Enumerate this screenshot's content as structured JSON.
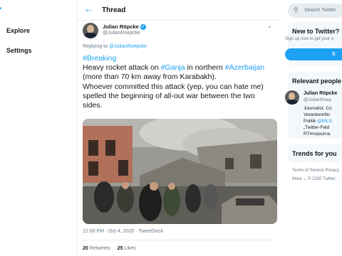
{
  "sidebar": {
    "items": [
      {
        "label": "Explore"
      },
      {
        "label": "Settings"
      }
    ]
  },
  "header": {
    "back_icon": "arrow-left-icon",
    "title": "Thread"
  },
  "tweet": {
    "author_name": "Julian Röpcke",
    "author_handle": "@JulianRoepcke",
    "replying_prefix": "Replying to",
    "replying_handle": "@JulianRoepcke",
    "line1": "#Breaking",
    "line2_pre": "Heavy rocket attack on ",
    "line2_tag1": "#Ganja",
    "line2_mid": " in northern ",
    "line2_tag2": "#Azerbaijan",
    "line3": "(more than 70 km away from Karabakh).",
    "line4": "Whoever committed this attack (yep, you can hate me)",
    "line5": "spelled the beginning of all-out war between the two",
    "line6": "sides.",
    "meta": "12:00 PM - Oct 4, 2020 · TweetDeck",
    "retweets_count": "20",
    "retweets_label": "Retweets",
    "likes_count": "25",
    "likes_label": "Likes"
  },
  "right": {
    "search_placeholder": "Search Twitter",
    "new_title": "New to Twitter?",
    "new_sub": "Sign up now to get your o",
    "signup_label": "S",
    "relevant_title": "Relevant people",
    "person_name": "Julian Röpcke",
    "person_handle": "@JulianRoep",
    "bio_line1": "Journalist. Co",
    "bio_line2": "Verantwortlic",
    "bio_line3_pre": "Politik ",
    "bio_line3_link": "@BILD",
    "bio_line4": "„Twitter-Feld",
    "bio_line5": "RT≠nojourna",
    "trends_title": "Trends for you",
    "footer_line1": "Terms of Service   Privacy",
    "footer_line2": "More ⌄  © 2020 Twitter,"
  },
  "colors": {
    "accent": "#1da1f2",
    "text": "#14171a",
    "muted": "#657786",
    "border": "#e6ecf0"
  }
}
